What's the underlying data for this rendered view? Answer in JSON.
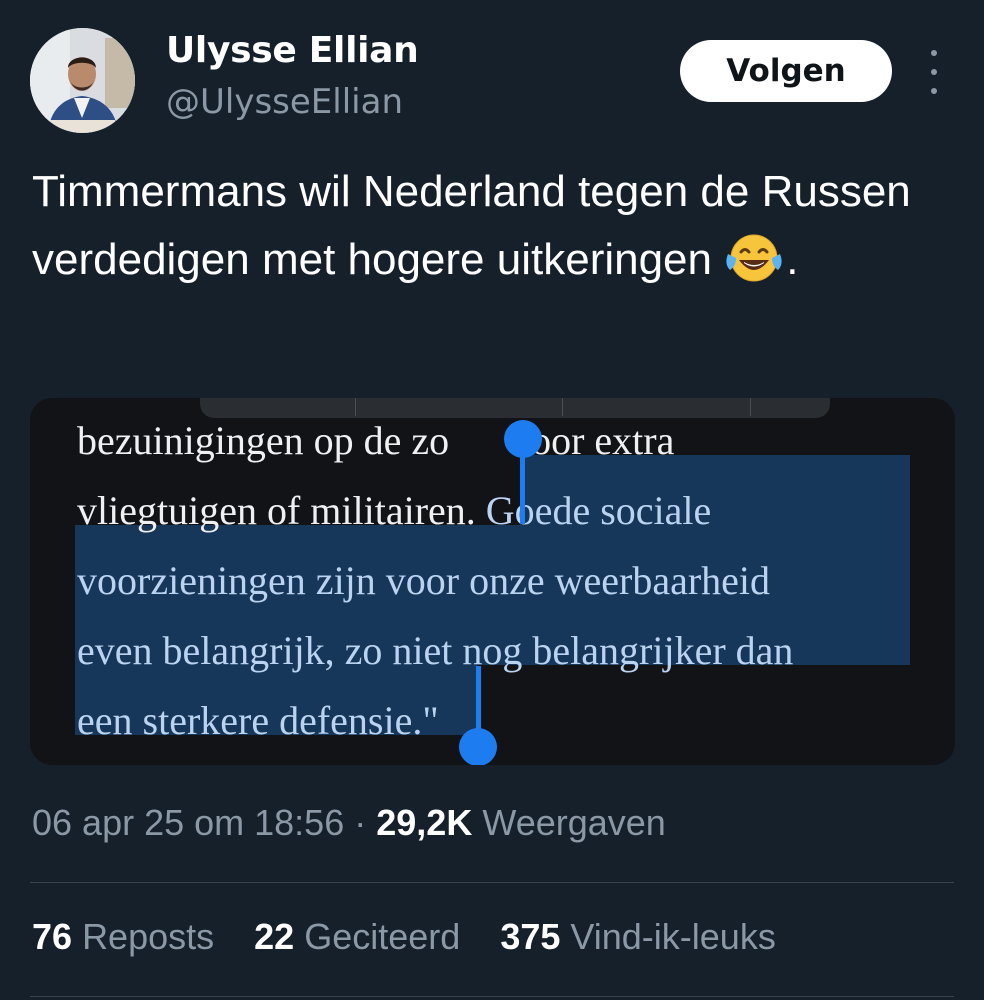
{
  "author": {
    "display_name": "Ulysse Ellian",
    "handle": "@UlysseEllian",
    "avatar_icon": "profile-photo"
  },
  "follow_label": "Volgen",
  "more_icon": "more-vertical-icon",
  "tweet": {
    "text_before_emoji": "Timmermans wil Nederland tegen de Russen verdedigen met hogere uitkeringen",
    "emoji": "face-with-tears-of-joy",
    "text_after_emoji": "."
  },
  "media": {
    "line1": "bezuinigingen op de zo",
    "line1_after_handle": "voor extra",
    "line2_unselected": "vliegtuigen of militairen. ",
    "line2_selected": "Goede sociale",
    "line3": "voorzieningen zijn voor onze weerbaarheid",
    "line4": "even belangrijk, zo niet nog belangrijker dan",
    "line5": "een sterkere defensie.\"",
    "selection_color": "#17375a",
    "handle_color": "#1d7df0"
  },
  "meta": {
    "timestamp": "06 apr 25 om 18:56",
    "separator": "·",
    "views_count": "29,2K",
    "views_label": "Weergaven"
  },
  "stats": {
    "reposts_count": "76",
    "reposts_label": "Reposts",
    "quotes_count": "22",
    "quotes_label": "Geciteerd",
    "likes_count": "375",
    "likes_label": "Vind-ik-leuks"
  }
}
